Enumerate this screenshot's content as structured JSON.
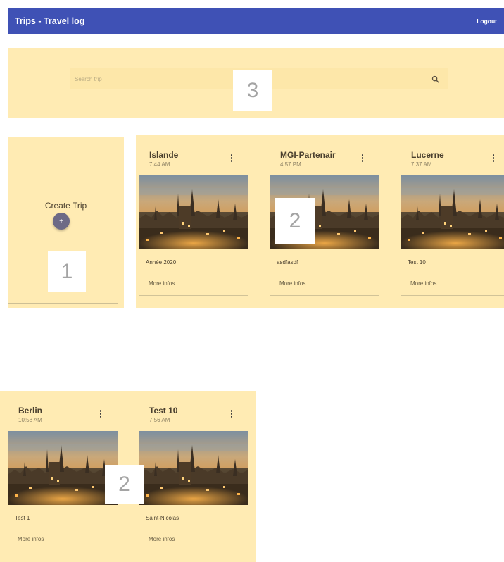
{
  "app": {
    "title": "Trips - Travel log",
    "logout_label": "Logout"
  },
  "search": {
    "placeholder": "Search trip",
    "icon": "search-icon"
  },
  "create_trip": {
    "label": "Create Trip",
    "fab_icon": "+"
  },
  "markers": {
    "create": "1",
    "cards": "2",
    "search": "3"
  },
  "trips": [
    {
      "title": "Islande",
      "time": "7:44 AM",
      "description": "Année 2020",
      "more_label": "More infos"
    },
    {
      "title": "MGI-Partenair",
      "time": "4:57 PM",
      "description": "asdfasdf",
      "more_label": "More infos"
    },
    {
      "title": "Lucerne",
      "time": "7:37 AM",
      "description": "Test 10",
      "more_label": "More infos"
    },
    {
      "title": "Berlin",
      "time": "10:58 AM",
      "description": "Test 1",
      "more_label": "More infos"
    },
    {
      "title": "Test 10",
      "time": "7:56 AM",
      "description": "Saint-Nicolas",
      "more_label": "More infos"
    }
  ],
  "colors": {
    "appbar": "#3f51b5",
    "panel": "#ffebb3",
    "fab": "#6d6a86"
  }
}
